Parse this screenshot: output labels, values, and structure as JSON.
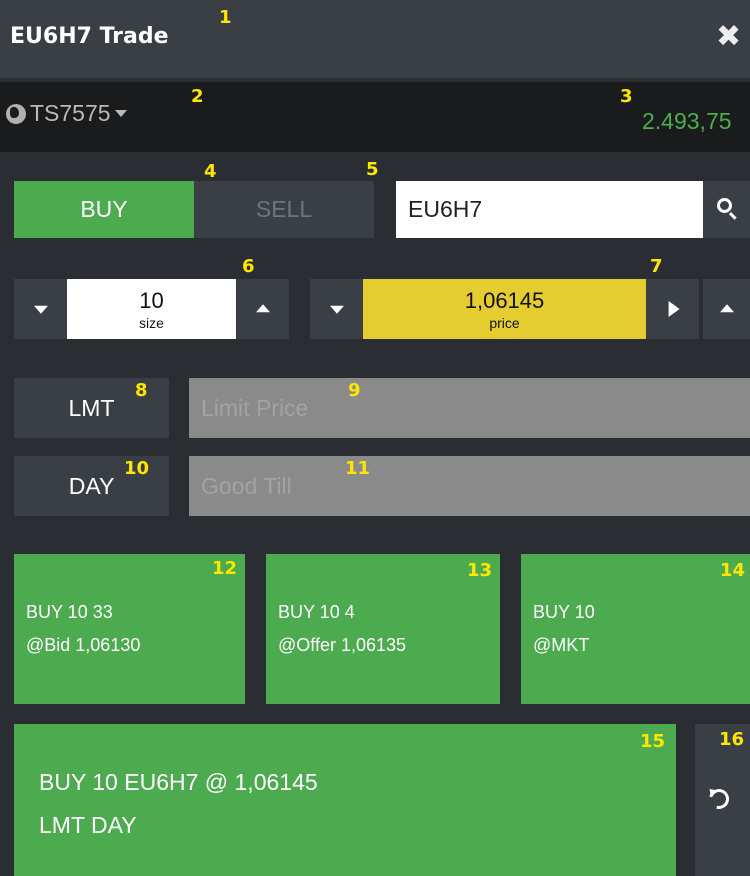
{
  "window": {
    "title": "EU6H7 Trade",
    "close_icon": "close-icon"
  },
  "account": {
    "id": "TS7575",
    "balance": "2.493,75",
    "balance_color": "#4cae4c"
  },
  "side": {
    "buy_label": "BUY",
    "sell_label": "SELL",
    "selected": "BUY"
  },
  "search": {
    "value": "EU6H7",
    "icon": "search-icon"
  },
  "size": {
    "value": "10",
    "label": "size"
  },
  "price": {
    "value": "1,06145",
    "label": "price",
    "highlight_color": "#e6cd2f"
  },
  "order_type": {
    "label": "LMT",
    "limit_price_placeholder": "Limit Price"
  },
  "tif": {
    "label": "DAY",
    "good_till_placeholder": "Good Till"
  },
  "quick_orders": [
    {
      "line1": "BUY 10 33",
      "line2": "@Bid 1,06130"
    },
    {
      "line1": "BUY 10 4",
      "line2": "@Offer 1,06135"
    },
    {
      "line1": "BUY 10",
      "line2": "@MKT"
    }
  ],
  "submit": {
    "line1": "BUY 10 EU6H7 @ 1,06145",
    "line2": "LMT DAY"
  },
  "markers": [
    "1",
    "2",
    "3",
    "4",
    "5",
    "6",
    "7",
    "8",
    "9",
    "10",
    "11",
    "12",
    "13",
    "14",
    "15",
    "16"
  ],
  "colors": {
    "buy_green": "#4caa4f",
    "panel_gray": "#3a3f46",
    "marker_yellow": "#ffe600"
  }
}
